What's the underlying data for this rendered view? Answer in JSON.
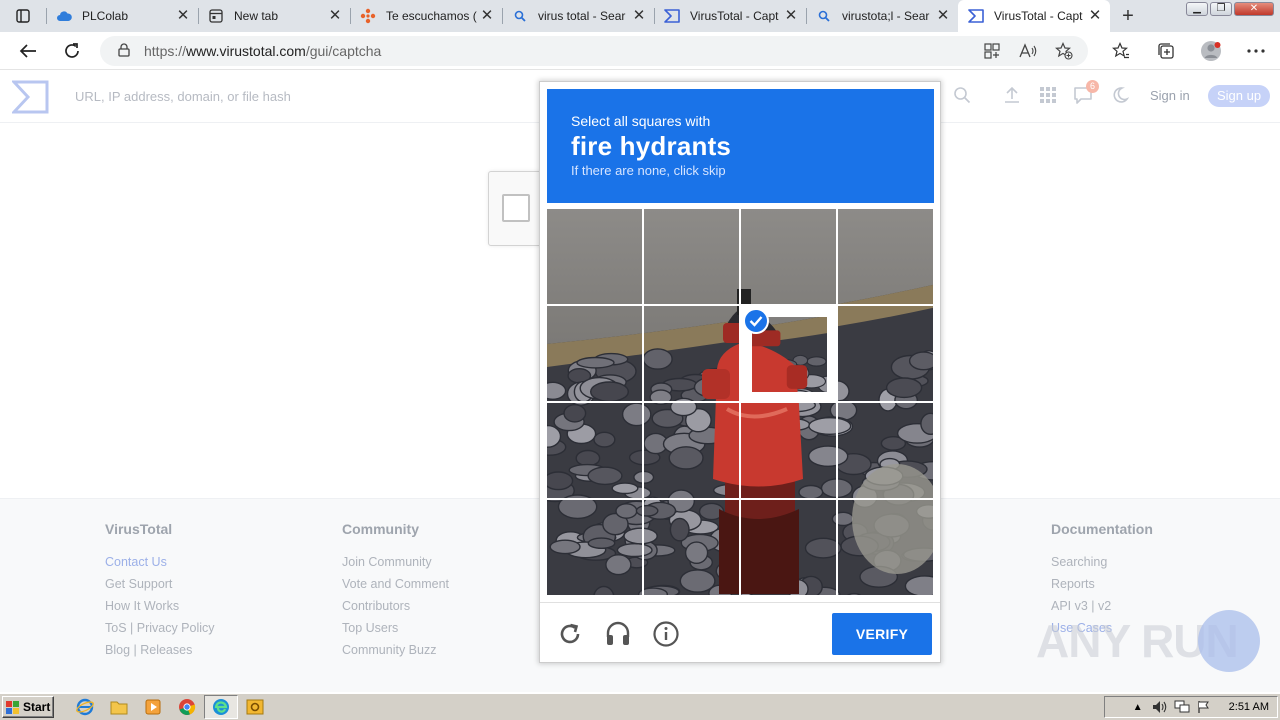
{
  "browser": {
    "tabs": [
      {
        "title": "PLColab",
        "icon": "cloud-icon",
        "active": false
      },
      {
        "title": "New tab",
        "icon": "newtab-icon",
        "active": false
      },
      {
        "title": "Te escuchamos (",
        "icon": "feedback-icon",
        "active": false
      },
      {
        "title": "virus total - Sear",
        "icon": "search-icon",
        "active": false
      },
      {
        "title": "VirusTotal - Capt",
        "icon": "virustotal-icon",
        "active": false
      },
      {
        "title": "virustota;l - Sear",
        "icon": "search-icon",
        "active": false
      },
      {
        "title": "VirusTotal - Capt",
        "icon": "virustotal-icon",
        "active": true
      }
    ],
    "address": {
      "scheme": "https://",
      "host": "www.virustotal.com",
      "path": "/gui/captcha"
    }
  },
  "vt": {
    "search_placeholder": "URL, IP address, domain, or file hash",
    "notification_count": "6",
    "signin": "Sign in",
    "signup": "Sign up"
  },
  "footer": {
    "columns": [
      {
        "heading": "VirusTotal",
        "links": [
          "Contact Us",
          "Get Support",
          "How It Works",
          "ToS | Privacy Policy",
          "Blog | Releases"
        ]
      },
      {
        "heading": "Community",
        "links": [
          "Join Community",
          "Vote and Comment",
          "Contributors",
          "Top Users",
          "Community Buzz"
        ]
      },
      {
        "heading": "Documentation",
        "links": [
          "Searching",
          "Reports",
          "API v3 | v2",
          "Use Cases"
        ]
      }
    ]
  },
  "captcha": {
    "prompt_line1": "Select all squares with",
    "prompt_target": "fire hydrants",
    "prompt_line3": "If there are none, click skip",
    "grid_rows": 4,
    "grid_cols": 4,
    "selected_tiles": [
      6
    ],
    "verify_label": "VERIFY"
  },
  "watermark": {
    "text": "ANY RUN"
  },
  "taskbar": {
    "start_label": "Start",
    "clock": "2:51 AM"
  },
  "colors": {
    "captcha_blue": "#1a73e8",
    "hydrant_red": "#c8392f"
  }
}
